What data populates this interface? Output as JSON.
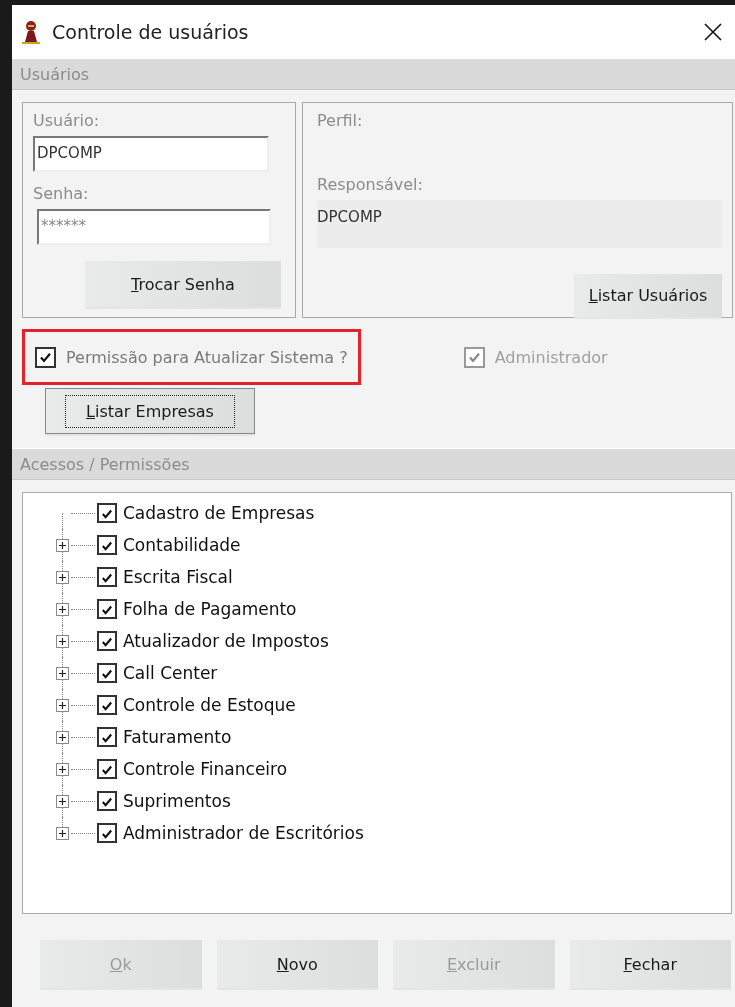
{
  "window": {
    "title": "Controle de usuários"
  },
  "users_section": {
    "title": "Usuários",
    "user_field": {
      "label": "Usuário:",
      "value": "DPCOMP"
    },
    "password_field": {
      "label": "Senha:",
      "value": "******"
    },
    "change_password_button": {
      "label": "Trocar Senha",
      "disabled": false
    },
    "profile": {
      "label": "Perfil:"
    },
    "responsible": {
      "label": "Responsável:",
      "value": "DPCOMP"
    },
    "list_users_button": {
      "label": "Listar Usuários",
      "disabled": false
    },
    "checkboxes": [
      {
        "label": "Permissão para Atualizar Sistema ?",
        "checked": true,
        "disabled": false,
        "highlighted": true
      },
      {
        "label": "Administrador",
        "checked": true,
        "disabled": true,
        "highlighted": false
      }
    ],
    "list_companies_button": {
      "label": "Listar Empresas",
      "disabled": false,
      "focused": true
    }
  },
  "permissions_section": {
    "title": "Acessos / Permissões",
    "tree": [
      {
        "label": "Cadastro de Empresas",
        "checked": true
      },
      {
        "label": "Contabilidade",
        "checked": true,
        "expanded": false
      },
      {
        "label": "Escrita Fiscal",
        "checked": true,
        "expanded": false
      },
      {
        "label": "Folha de Pagamento",
        "checked": true,
        "expanded": false
      },
      {
        "label": "Atualizador de Impostos",
        "checked": true,
        "expanded": false
      },
      {
        "label": "Call Center",
        "checked": true,
        "expanded": false
      },
      {
        "label": "Controle de Estoque",
        "checked": true,
        "expanded": false
      },
      {
        "label": "Faturamento",
        "checked": true,
        "expanded": false
      },
      {
        "label": "Controle Financeiro",
        "checked": true,
        "expanded": false
      },
      {
        "label": "Suprimentos",
        "checked": true,
        "expanded": false
      },
      {
        "label": "Administrador de Escritórios",
        "checked": true,
        "expanded": false
      }
    ]
  },
  "buttons": [
    {
      "label": "Ok",
      "disabled": true
    },
    {
      "label": "Novo",
      "disabled": false
    },
    {
      "label": "Excluir",
      "disabled": true
    },
    {
      "label": "Fechar",
      "disabled": false
    }
  ]
}
